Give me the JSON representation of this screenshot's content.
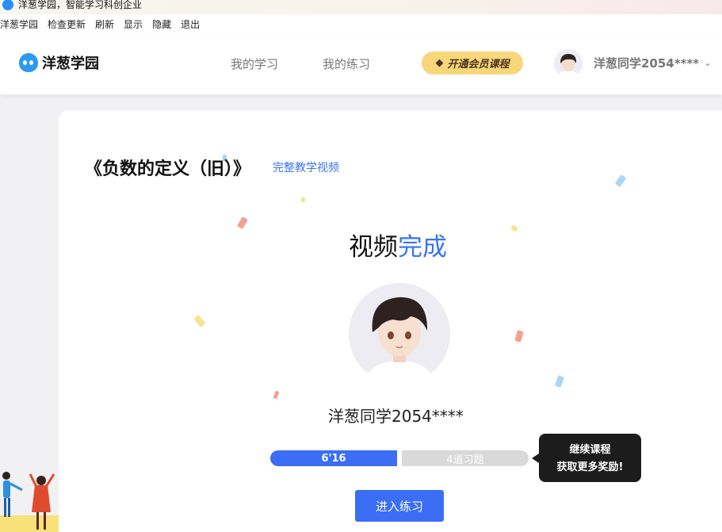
{
  "window": {
    "title": "洋葱学园，智能学习科创企业"
  },
  "menubar": {
    "items": [
      "洋葱学园",
      "检查更新",
      "刷新",
      "显示",
      "隐藏",
      "退出"
    ]
  },
  "navbar": {
    "logo_text": "洋葱学园",
    "links": [
      "我的学习",
      "我的练习"
    ],
    "vip_label": "开通会员课程",
    "user_name": "洋葱同学2054****"
  },
  "lesson": {
    "title": "《负数的定义（旧）》",
    "link_label": "完整教学视频"
  },
  "completion": {
    "headline_black": "视频",
    "headline_blue": "完成",
    "user_name": "洋葱同学2054****",
    "progress": {
      "time_label": "6'16",
      "exercise_label": "4道习题"
    },
    "tooltip_line1": "继续课程",
    "tooltip_line2": "获取更多奖励!",
    "practice_button": "进入练习"
  },
  "colors": {
    "accent_blue": "#3b6ef5",
    "link_blue": "#3b73f5",
    "vip_gold": "#f9d67a",
    "tooltip_bg": "#1c1c1c"
  },
  "icons": {
    "app": "onion-logo-icon",
    "vip": "diamond-icon",
    "dropdown": "chevron-down-icon"
  }
}
